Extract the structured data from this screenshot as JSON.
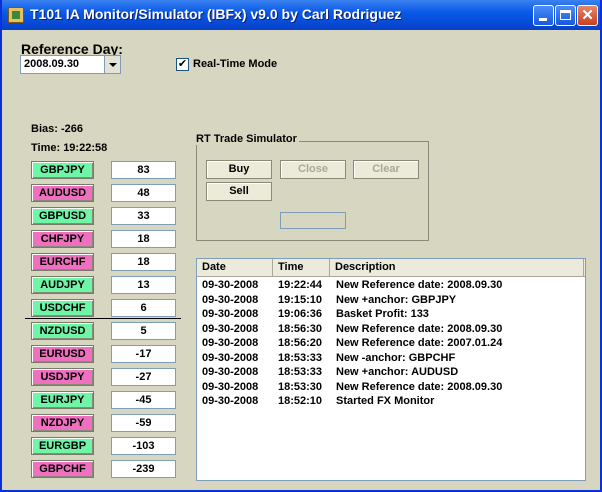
{
  "window": {
    "title": "T101 IA Monitor/Simulator (IBFx) v9.0 by Carl Rodriguez"
  },
  "reference": {
    "label": "Reference Day:",
    "selected_date": "2008.09.30"
  },
  "realtime": {
    "label": "Real-Time Mode",
    "checked_glyph": "✔"
  },
  "bias": "Bias:  -266",
  "time": "Time: 19:22:58",
  "pairs": [
    {
      "name": "GBPJPY",
      "value": "83",
      "color": "#6ef5a6"
    },
    {
      "name": "AUDUSD",
      "value": "48",
      "color": "#f070c0"
    },
    {
      "name": "GBPUSD",
      "value": "33",
      "color": "#6ef5a6"
    },
    {
      "name": "CHFJPY",
      "value": "18",
      "color": "#f070c0"
    },
    {
      "name": "EURCHF",
      "value": "18",
      "color": "#f070c0"
    },
    {
      "name": "AUDJPY",
      "value": "13",
      "color": "#6ef5a6"
    },
    {
      "name": "USDCHF",
      "value": "6",
      "color": "#6ef5a6"
    },
    {
      "name": "NZDUSD",
      "value": "5",
      "color": "#6ef5a6"
    },
    {
      "name": "EURUSD",
      "value": "-17",
      "color": "#f070c0"
    },
    {
      "name": "USDJPY",
      "value": "-27",
      "color": "#f070c0"
    },
    {
      "name": "EURJPY",
      "value": "-45",
      "color": "#6ef5a6"
    },
    {
      "name": "NZDJPY",
      "value": "-59",
      "color": "#f070c0"
    },
    {
      "name": "EURGBP",
      "value": "-103",
      "color": "#6ef5a6"
    },
    {
      "name": "GBPCHF",
      "value": "-239",
      "color": "#f070c0"
    }
  ],
  "simulator": {
    "title": "RT Trade Simulator",
    "buy": "Buy",
    "close": "Close",
    "clear": "Clear",
    "sell": "Sell",
    "field_value": ""
  },
  "log": {
    "columns": [
      "Date",
      "Time",
      "Description"
    ],
    "rows": [
      [
        "09-30-2008",
        "19:22:44",
        "New Reference date: 2008.09.30"
      ],
      [
        "09-30-2008",
        "19:15:10",
        "New +anchor: GBPJPY"
      ],
      [
        "09-30-2008",
        "19:06:36",
        "Basket Profit:  133"
      ],
      [
        "09-30-2008",
        "18:56:30",
        "New Reference date: 2008.09.30"
      ],
      [
        "09-30-2008",
        "18:56:20",
        "New Reference date: 2007.01.24"
      ],
      [
        "09-30-2008",
        "18:53:33",
        "New -anchor: GBPCHF"
      ],
      [
        "09-30-2008",
        "18:53:33",
        "New +anchor: AUDUSD"
      ],
      [
        "09-30-2008",
        "18:53:30",
        "New Reference date: 2008.09.30"
      ],
      [
        "09-30-2008",
        "18:52:10",
        "Started FX Monitor"
      ]
    ]
  }
}
